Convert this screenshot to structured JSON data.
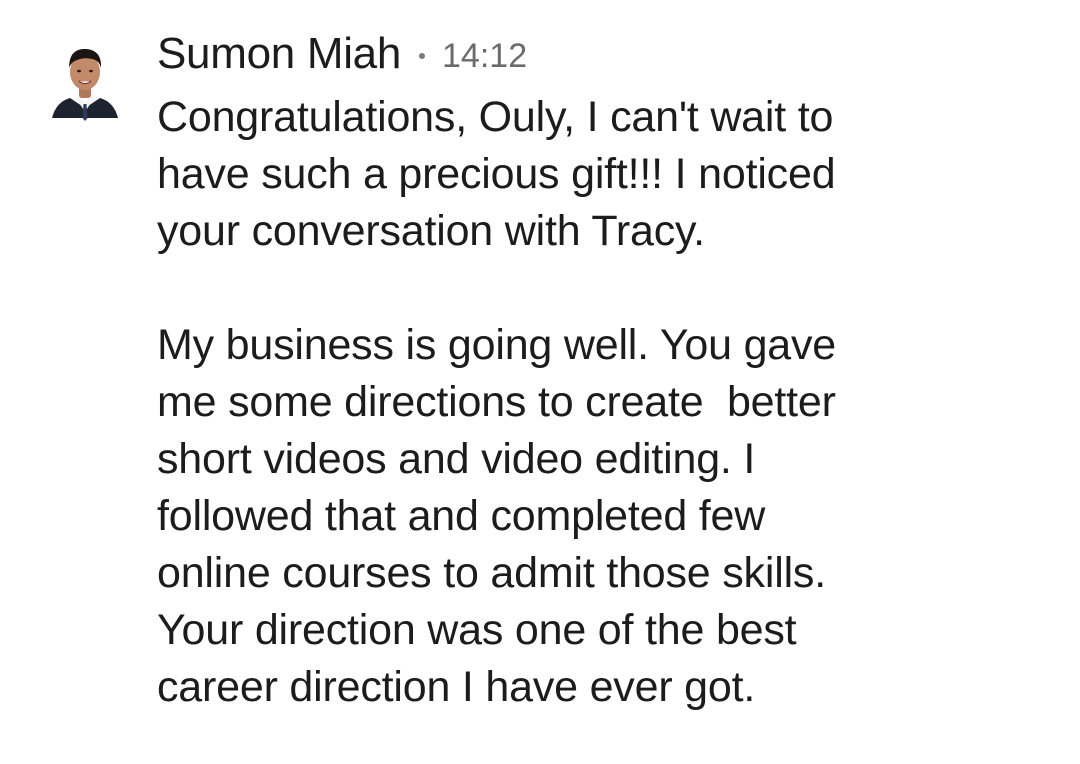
{
  "message": {
    "sender": "Sumon Miah",
    "separator": "•",
    "time": "14:12",
    "avatar_icon": "profile-photo",
    "paragraphs": [
      {
        "lines": [
          "Congratulations, Ouly, I can't wait to",
          "have such a precious gift!!! I noticed",
          "your conversation with Tracy."
        ]
      },
      {
        "lines": [
          "My business is going well. You gave",
          "me some directions to create  better",
          "short videos and video editing. I",
          "followed that and completed few",
          "online courses to admit those skills.",
          "Your direction was one of the best",
          "career direction I have ever got."
        ]
      }
    ]
  }
}
